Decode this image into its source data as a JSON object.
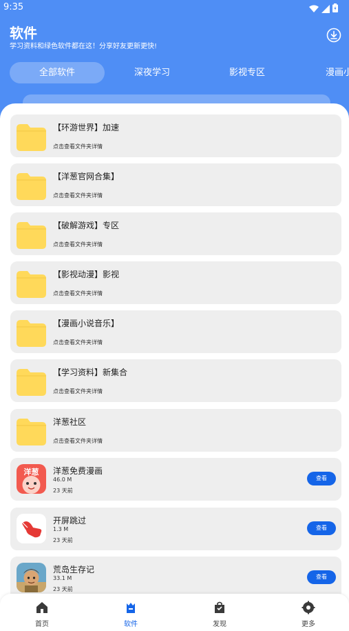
{
  "status": {
    "time": "9:35"
  },
  "header": {
    "title": "软件",
    "subtitle": "学习资料和绿色软件都在这！分享好友更新更快!",
    "download_icon": "download-circle-icon"
  },
  "tabs": [
    {
      "label": "全部软件",
      "active": true
    },
    {
      "label": "深夜学习",
      "active": false
    },
    {
      "label": "影视专区",
      "active": false
    },
    {
      "label": "漫画小说",
      "active": false
    }
  ],
  "folders": [
    {
      "title": "【环游世界】加速",
      "subtitle": "点击查看文件夹详情"
    },
    {
      "title": "【洋葱官网合集】",
      "subtitle": "点击查看文件夹详情"
    },
    {
      "title": "【破解游戏】专区",
      "subtitle": "点击查看文件夹详情"
    },
    {
      "title": "【影视动漫】影视",
      "subtitle": "点击查看文件夹详情"
    },
    {
      "title": "【漫画小说音乐】",
      "subtitle": "点击查看文件夹详情"
    },
    {
      "title": "【学习资料】新集合",
      "subtitle": "点击查看文件夹详情"
    },
    {
      "title": "洋葱社区",
      "subtitle": "点击查看文件夹详情"
    }
  ],
  "apps": [
    {
      "name": "洋葱免费漫画",
      "size": "46.0 M",
      "time": "23 天前",
      "button": "查看",
      "icon_text": "洋葱"
    },
    {
      "name": "开屏跳过",
      "size": "1.3 M",
      "time": "23 天前",
      "button": "查看"
    },
    {
      "name": "荒岛生存记",
      "size": "33.1 M",
      "time": "23 天前",
      "button": "查看"
    }
  ],
  "bottom_nav": [
    {
      "label": "首页",
      "icon": "home-icon",
      "active": false
    },
    {
      "label": "软件",
      "icon": "software-bag-icon",
      "active": true
    },
    {
      "label": "发现",
      "icon": "discover-bag-icon",
      "active": false
    },
    {
      "label": "更多",
      "icon": "more-gear-icon",
      "active": false
    }
  ],
  "colors": {
    "header_blue": "#4f8ef5",
    "accent_blue": "#1565e8",
    "folder_yellow": "#ffd95a",
    "card_gray": "#eeeeee"
  }
}
